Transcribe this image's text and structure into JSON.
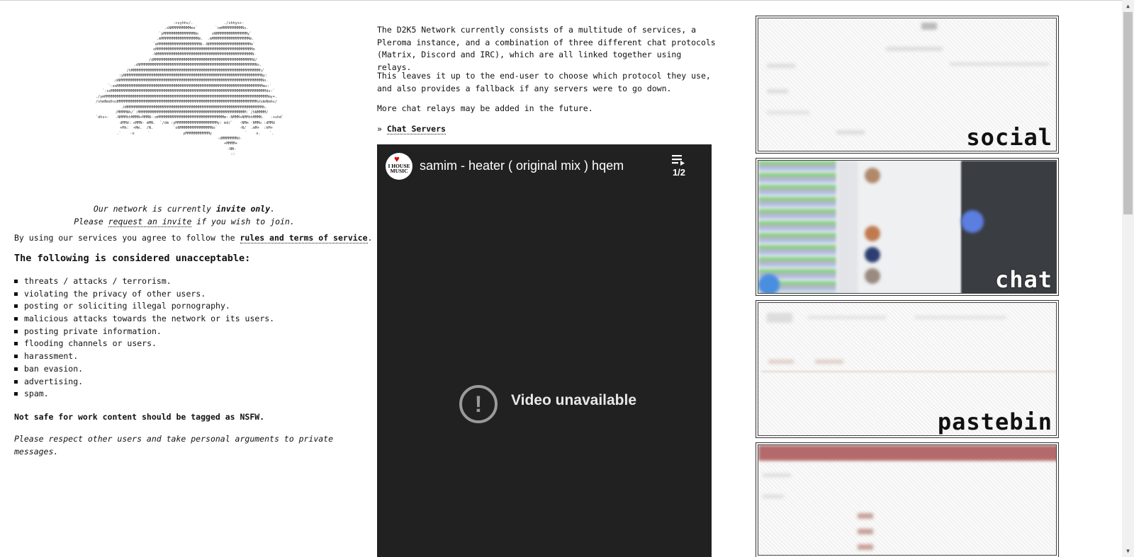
{
  "ascii_art": "                    -+syhhs/.              ./shhys+-\n                  .sNMMMMMMMMMmo`        `omMMMMMMMMMNs.\n                 `yMMMMMMMMMMMMMMNo      oNMMMMMMMMMMMMMMy`\n                 .mMMMMMMMMMMMMMMMMMm.  .mMMMMMMMMMMMMMMMMMm.\n                `mMMMMMMMMMMMMMMMMMMMN--NMMMMMMMMMMMMMMMMMMMm`\n                oMMMMMMMMMMMMMMMMMMMMMMMMMMMMMMMMMMMMMMMMMMMMo\n                -NMMMMMMMMMMMMMMMMMMMMMMMMMMMMMMMMMMMMMMMMMMMN-\n               /dMMMMMMMMMMMMMMMMMMMMMMMMMMMMMMMMMMMMMMMMMMMMMd/\n          .sNMMMMMMMMMMMMMMMMMMMMMMMMMMMMMMMMMMMMMMMMMMMMMMMMMMMMNs.\n        /hMMMMMMMMMMMMMMMMMMMMMMMMMMMMMMMMMMMMMMMMMMMMMMMMMMMMMMMMMMh/\n      :yNMMMMMMMMMMMMMMMMMMMMMMMMMMMMMMMMMMMMMMMMMMMMMMMMMMMMMMMMMMMMMNy:\n    .oNMMMMMMMMMMMMMMMMMMMMMMMMMMMMMMMMMMMMMMMMMMMMMMMMMMMMMMMMMMMMMMMMNo.\n   `:smMMMMMMMMMMMMMMMMMMMMMMMMMMMMMMMMMMMMMMMMMMMMMMMMMMMMMMMMMMMMMMMMMMms:`\n  `:sdMMMMMMMMMMMMMMMMMMMMMMMMMMMMMMMMMMMMMMMMMMMMMMMMMMMMMMMMMMMMMMMMMMMMMMds:`\n./ymMMMMMMMMMMMMMMMMMMMMMMMMMMMMMMMMMMMMMMMMMMMMMMMMMMMMMMMMMMMMMMMMMMMMMMMMMMmy+.\n/shmNmdhsdMMMMMMMMMMMMMMMMMMMMMMMMMMMMMMMMMMMMMMMMMMMMMMMMMMMMMMMMMMMMMMMshdmNmhs/\n       .hMMMMMMMMMMMMMMMMMMMMMMMMMMMMMMMMMMMMMMMMMMMMMMMMMMMMMMMMMMMMMMh.\n     /MMMMNh/`:MMMMMMMMMMMMMMMMMMMMMMMMMMMMMMMMMMMMMMMMMMMMMMMMM:`/hNMMMM/\n   `dhs+-   .NMMMhhMMMN+MMMN-:mMMMMMMMMMMMMMMMMMMMMMMMMMMMMMMm:-NMMM+NMMhhMMMN.   -+shd`\n          dMMd: oMMN- mMN.  `/dm :yMMMMMMMMMMMMMMMMMMMy: md/`   -NMm -NMMo :dMMd\n         +Mh:  +Mm.  /N.         `oNMMMMMMMMMMMMMMNo`          -N/  .mM+  :hM+\n        .`    -o      `               yMMMMMMMMMMMy               `    o.    `.\n                                       -dMMMMMMMd-\n                                        +MMMM+\n                                         -NN-\n                                          ::",
  "invite": {
    "line1_pre": "Our network is currently ",
    "line1_bold": "invite only",
    "line1_post": ".",
    "line2_pre": "Please ",
    "line2_link": "request an invite",
    "line2_post": " if you wish to join."
  },
  "agree": {
    "pre": "By using our services you agree to follow the ",
    "link": "rules and terms of service",
    "post": "."
  },
  "unacceptable_heading": "The following is considered unacceptable:",
  "rules": [
    "threats / attacks / terrorism.",
    "violating the privacy of other users.",
    "posting or soliciting illegal pornography.",
    "malicious attacks towards the network or its users.",
    "posting private information.",
    "flooding channels or users.",
    "harassment.",
    "ban evasion.",
    "advertising.",
    "spam."
  ],
  "nsfw_note": "Not safe for work content should be tagged as NSFW.",
  "respect_note": "Please respect other users and take personal arguments to private messages.",
  "intro": {
    "p1": "The D2K5 Network currently consists of a multitude of services, a Pleroma instance, and a combination of three different chat protocols (Matrix, Discord and IRC), which are all linked together using relays.",
    "p2": "This leaves it up to the end-user to choose which protocol they use, and also provides a fallback if any servers were to go down.",
    "p3": "More chat relays may be added in the future.",
    "chat_servers_prefix": "» ",
    "chat_servers_link": "Chat Servers"
  },
  "video": {
    "channel_logo_text": "I HOUSE MUSIC",
    "title": "samim - heater ( original mix ) hqem",
    "playlist_position": "1/2",
    "error": "Video unavailable",
    "error_icon": "!"
  },
  "services": [
    {
      "label": "social"
    },
    {
      "label": "chat"
    },
    {
      "label": "pastebin"
    },
    {
      "label": ""
    }
  ],
  "colors": {
    "video_bg": "#212121",
    "text": "#111111"
  }
}
